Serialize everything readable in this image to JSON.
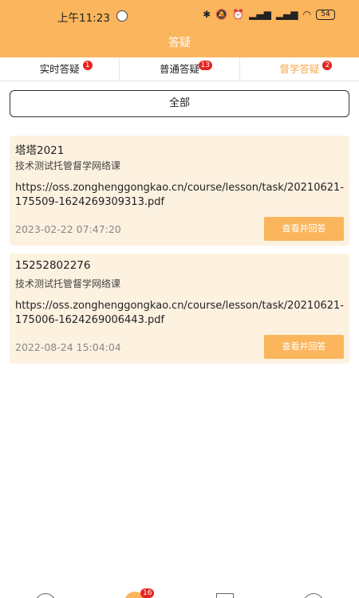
{
  "status_bar": {
    "time": "上午11:23",
    "battery": "54"
  },
  "header": {
    "title": "答疑"
  },
  "tabs": [
    {
      "label": "实时答疑",
      "badge": "1",
      "active": false
    },
    {
      "label": "普通答疑",
      "badge": "13",
      "active": false
    },
    {
      "label": "督学答疑",
      "badge": "2",
      "active": true
    }
  ],
  "filter": {
    "label": "全部"
  },
  "questions": [
    {
      "name": "塔塔2021",
      "course": "技术测试托管督学网络课",
      "link": "https://oss.zonghenggongkao.cn/course/lesson/task/20210621-175509-1624269309313.pdf",
      "date": "2023-02-22 07:47:20",
      "action": "查看并回答"
    },
    {
      "name": "15252802276",
      "course": "技术测试托管督学网络课",
      "link": "https://oss.zonghenggongkao.cn/course/lesson/task/20210621-175006-1624269006443.pdf",
      "date": "2022-08-24 15:04:04",
      "action": "查看并回答"
    }
  ],
  "bottom_nav": {
    "center_badge": "16"
  },
  "colors": {
    "accent": "#fbb55c",
    "card_bg": "#fdf1e0",
    "badge": "#e7251e"
  }
}
